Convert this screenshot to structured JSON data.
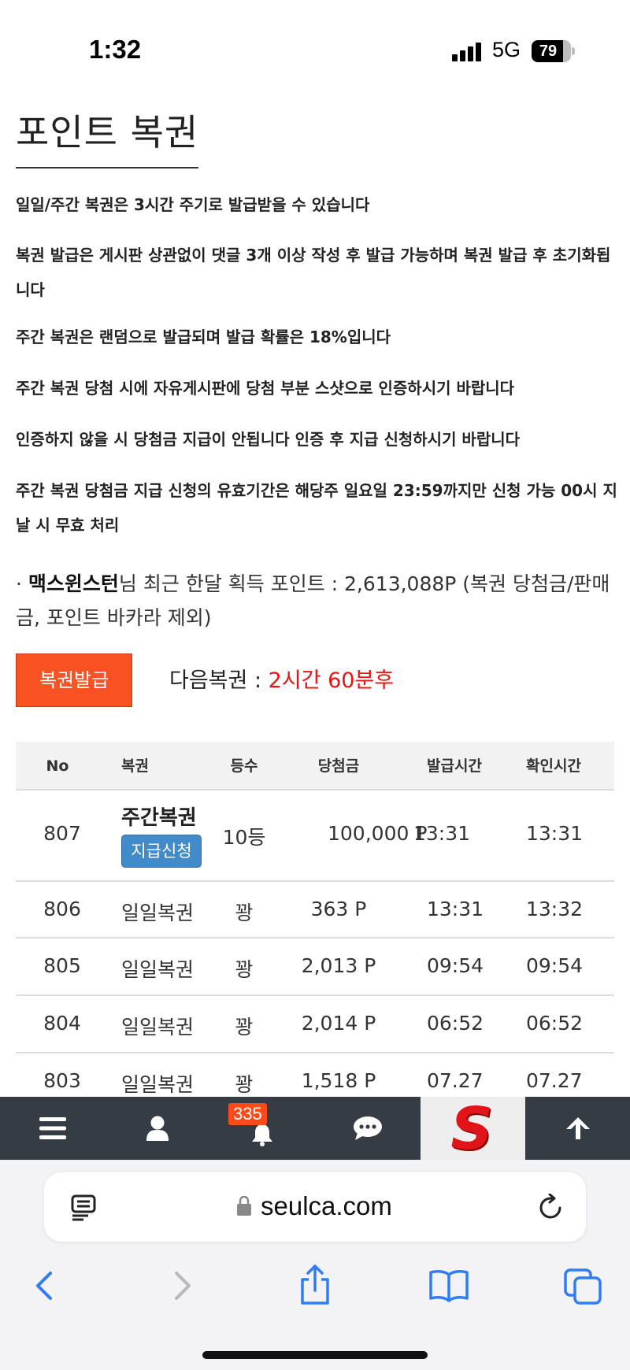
{
  "status_bar": {
    "time": "1:32",
    "network": "5G",
    "battery": "79",
    "battery_level": 0.79
  },
  "page": {
    "title": "포인트 복권",
    "notices": [
      "일일/주간 복권은 3시간 주기로 발급받을 수 있습니다",
      "복권 발급은 게시판 상관없이 댓글 3개 이상 작성 후 발급 가능하며 복권 발급 후 초기화됩니다",
      "주간 복권은 랜덤으로 발급되며 발급 확률은 18%입니다",
      "주간 복권 당첨 시에 자유게시판에 당첨 부분 스샷으로 인증하시기 바랍니다",
      "인증하지 않을 시 당첨금 지급이 안됩니다 인증 후 지급 신청하시기 바랍니다",
      "주간 복권 당첨금 지급 신청의 유효기간은 해당주 일요일 23:59까지만 신청 가능 00시 지날 시 무효 처리"
    ],
    "points_bullet": "·",
    "username": "맥스윈스턴",
    "points_text": "님 최근 한달 획득 포인트 : 2,613,088P (복권 당첨금/판매금, 포인트 바카라 제외)",
    "issue_button": "복권발급",
    "next_ticket_label": "다음복권 : ",
    "next_ticket_time": "2시간 60분후"
  },
  "table": {
    "headers": [
      "No",
      "복권",
      "등수",
      "당첨금",
      "발급시간",
      "확인시간"
    ],
    "claim_label": "지급신청",
    "rows": [
      {
        "no": "807",
        "ticket": "주간복권",
        "rank": "10등",
        "prize": "100,000 P",
        "issued": "13:31",
        "checked": "13:31"
      },
      {
        "no": "806",
        "ticket": "일일복권",
        "rank": "꽝",
        "prize": "363 P",
        "issued": "13:31",
        "checked": "13:32"
      },
      {
        "no": "805",
        "ticket": "일일복권",
        "rank": "꽝",
        "prize": "2,013 P",
        "issued": "09:54",
        "checked": "09:54"
      },
      {
        "no": "804",
        "ticket": "일일복권",
        "rank": "꽝",
        "prize": "2,014 P",
        "issued": "06:52",
        "checked": "06:52"
      },
      {
        "no": "803",
        "ticket": "일일복권",
        "rank": "꽝",
        "prize": "1,518 P",
        "issued": "07.27",
        "checked": "07.27"
      }
    ]
  },
  "app_nav": {
    "items": [
      "menu-icon",
      "user-icon",
      "bell-icon",
      "chat-icon",
      "site-logo",
      "arrow-up-icon"
    ],
    "notification_count": "335",
    "logo_letter": "S",
    "logo_color": "#e1141a",
    "bar_color": "#353c43"
  },
  "browser": {
    "url": "seulca.com",
    "accent": "#2f7cf6"
  }
}
